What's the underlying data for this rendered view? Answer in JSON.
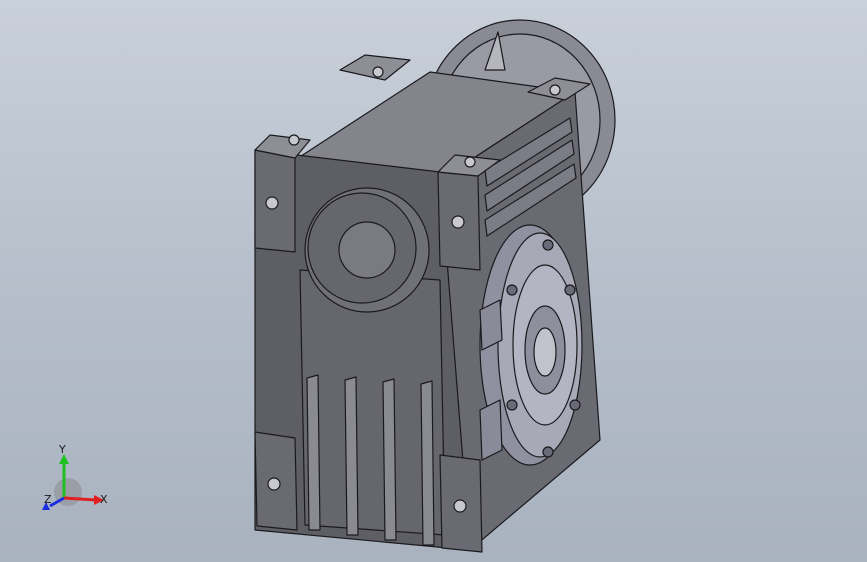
{
  "viewport": {
    "background_top": "#c9d0da",
    "background_bottom": "#a9b2bf",
    "model_name": "worm-gear-reducer"
  },
  "triad": {
    "x_label": "X",
    "y_label": "Y",
    "z_label": "Z",
    "x_color": "#e02020",
    "y_color": "#20c020",
    "z_color": "#1c2ee0"
  },
  "colors": {
    "body_dark": "#5c5c63",
    "body_mid": "#6e6e76",
    "body_light": "#8c8c95",
    "edge": "#1a1a1e",
    "flange_light": "#a6a6b2",
    "flange_mid": "#8e8e9c"
  }
}
